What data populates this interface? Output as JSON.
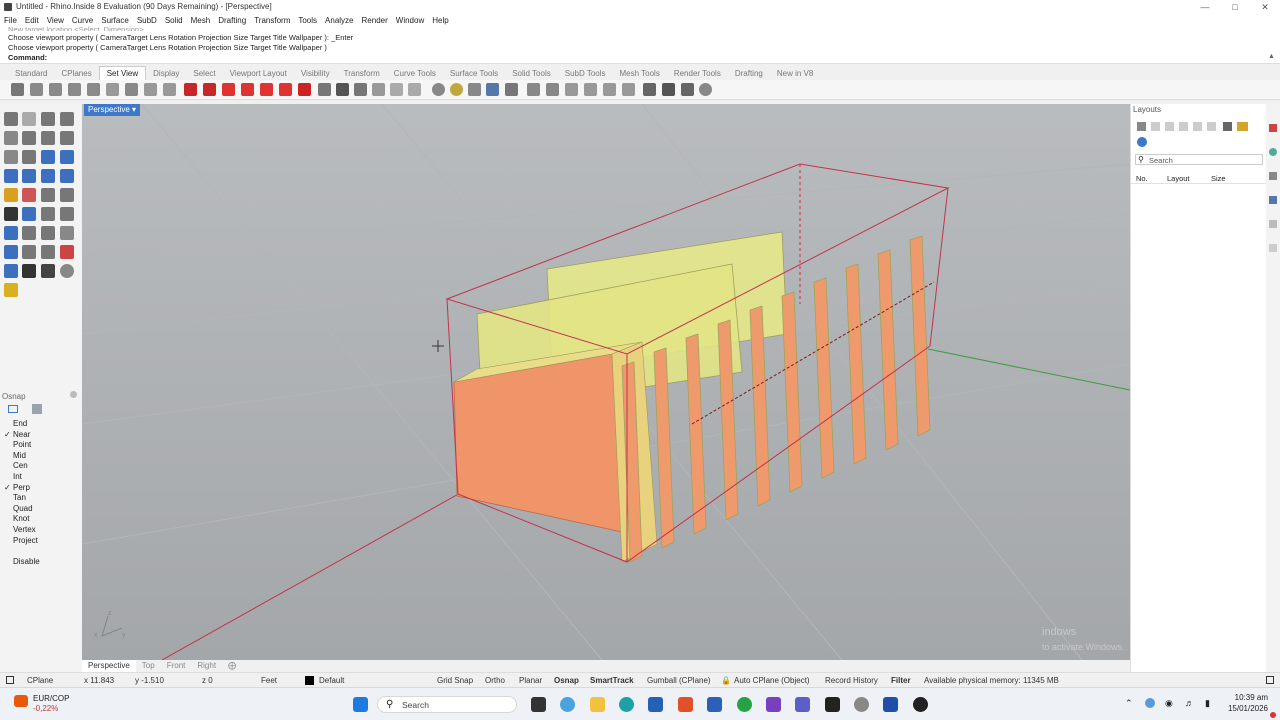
{
  "window": {
    "title": "Untitled - Rhino.Inside 8 Evaluation (90 Days Remaining) - [Perspective]",
    "minimize_icon": "minimize-icon",
    "maximize_icon": "maximize-icon",
    "close_icon": "close-icon"
  },
  "menu": [
    "File",
    "Edit",
    "View",
    "Curve",
    "Surface",
    "SubD",
    "Solid",
    "Mesh",
    "Drafting",
    "Transform",
    "Tools",
    "Analyze",
    "Render",
    "Window",
    "Help"
  ],
  "command": {
    "history_truncated": "New target location <Select, Dimension>",
    "line1": "Choose viewport property ( CameraTarget  Lens  Rotation  Projection  Size  Target  Title  Wallpaper ): _Enter",
    "line2": "Choose viewport property ( CameraTarget  Lens  Rotation  Projection  Size  Target  Title  Wallpaper )",
    "prompt_label": "Command:"
  },
  "toolbar_tabs": [
    "Standard",
    "CPlanes",
    "Set View",
    "Display",
    "Select",
    "Viewport Layout",
    "Visibility",
    "Transform",
    "Curve Tools",
    "Surface Tools",
    "Solid Tools",
    "SubD Tools",
    "Mesh Tools",
    "Render Tools",
    "Drafting",
    "New in V8"
  ],
  "active_tab": "Set View",
  "viewport": {
    "title": "Perspective",
    "tabs": [
      "Perspective",
      "Top",
      "Front",
      "Right"
    ],
    "active_tab": "Perspective",
    "watermark1": "indows",
    "watermark2": "to activate Windows.",
    "axis_x": "x",
    "axis_y": "y",
    "axis_z": "z"
  },
  "osnap": {
    "header": "Osnap",
    "items": [
      {
        "label": "End",
        "checked": false
      },
      {
        "label": "Near",
        "checked": true
      },
      {
        "label": "Point",
        "checked": false
      },
      {
        "label": "Mid",
        "checked": false
      },
      {
        "label": "Cen",
        "checked": false
      },
      {
        "label": "Int",
        "checked": false
      },
      {
        "label": "Perp",
        "checked": true
      },
      {
        "label": "Tan",
        "checked": false
      },
      {
        "label": "Quad",
        "checked": false
      },
      {
        "label": "Knot",
        "checked": false
      },
      {
        "label": "Vertex",
        "checked": false
      },
      {
        "label": "Project",
        "checked": false
      }
    ],
    "disable_label": "Disable"
  },
  "layouts": {
    "header": "Layouts",
    "search_placeholder": "Search",
    "columns": [
      "No.",
      "Layout",
      "Size"
    ]
  },
  "status": {
    "cplane": "CPlane",
    "x": "x 11.843",
    "y": "y -1.510",
    "z": "z 0",
    "units": "Feet",
    "layer": "Default",
    "grid_snap": "Grid Snap",
    "ortho": "Ortho",
    "planar": "Planar",
    "osnap": "Osnap",
    "smarttrack": "SmartTrack",
    "gumball": "Gumball (CPlane)",
    "auto_cplane": "Auto CPlane (Object)",
    "record_history": "Record History",
    "filter": "Filter",
    "memory": "Available physical memory: 11345 MB"
  },
  "taskbar": {
    "currency": "EUR/COP",
    "change": "-0,22%",
    "search_placeholder": "Search",
    "time": "10:39 am",
    "date": "15/01/2026"
  },
  "colors": {
    "accent": "#3d78c9",
    "viewport_bg": "#a9acaf",
    "bbox_red": "#c4314b",
    "panel_yellow": "#e6e88a",
    "panel_orange": "#f0956a"
  }
}
